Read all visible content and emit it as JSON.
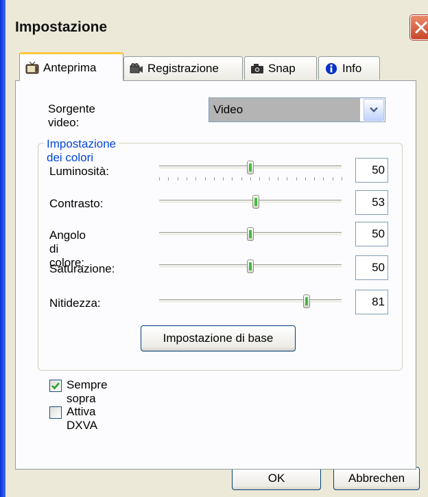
{
  "window": {
    "title": "Impostazione"
  },
  "tabs": [
    {
      "label": "Anteprima",
      "icon": "tv-icon",
      "active": true
    },
    {
      "label": "Registrazione",
      "icon": "camcorder-icon",
      "active": false
    },
    {
      "label": "Snap",
      "icon": "camera-icon",
      "active": false
    },
    {
      "label": "Info",
      "icon": "info-icon",
      "active": false
    }
  ],
  "source": {
    "label": "Sorgente video:",
    "value": "Video"
  },
  "colors_group": {
    "title": "Impostazione dei colori",
    "sliders": [
      {
        "label": "Luminosità:",
        "value": "50",
        "level": 0.5
      },
      {
        "label": "Contrasto:",
        "value": "53",
        "level": 0.53
      },
      {
        "label": "Angolo di colore:",
        "value": "50",
        "level": 0.5
      },
      {
        "label": "Saturazione:",
        "value": "50",
        "level": 0.5
      },
      {
        "label": "Nitidezza:",
        "value": "81",
        "level": 0.81
      }
    ],
    "reset_label": "Impostazione di base"
  },
  "options": [
    {
      "label": "Sempre sopra",
      "checked": true
    },
    {
      "label": "Attiva DXVA",
      "checked": false
    }
  ],
  "footer": {
    "ok_label": "OK",
    "cancel_label": "Abbrechen"
  },
  "colors": {
    "accent_tab": "#FFC83C",
    "group_title": "#0046D5",
    "check": "#21A121"
  }
}
